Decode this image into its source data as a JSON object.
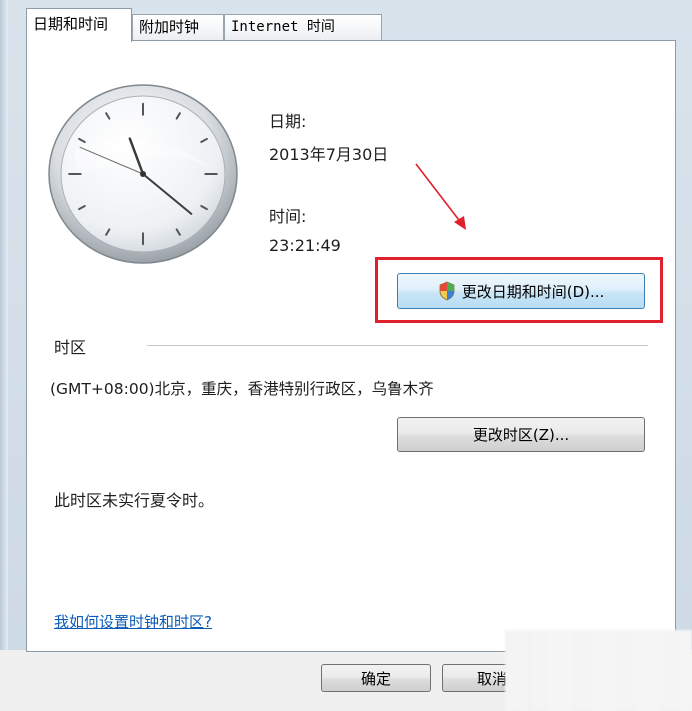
{
  "tabs": [
    {
      "label": "日期和时间",
      "active": true
    },
    {
      "label": "附加时钟",
      "active": false
    },
    {
      "label": "Internet 时间",
      "active": false
    }
  ],
  "date": {
    "label": "日期:",
    "value": "2013年7月30日"
  },
  "time": {
    "label": "时间:",
    "value": "23:21:49",
    "hour": 23,
    "minute": 21,
    "second": 49
  },
  "buttons": {
    "change_datetime": "更改日期和时间(D)...",
    "change_timezone": "更改时区(Z)...",
    "ok": "确定",
    "cancel": "取消"
  },
  "timezone": {
    "heading": "时区",
    "value": "(GMT+08:00)北京，重庆，香港特别行政区，乌鲁木齐",
    "dst_note": "此时区未实行夏令时。"
  },
  "help_link": "我如何设置时钟和时区?",
  "icons": {
    "clock": "analog-clock-icon",
    "shield": "uac-shield-icon",
    "arrow": "red-arrow-annotation"
  },
  "colors": {
    "highlight": "#e0202c",
    "link": "#0b5bb8",
    "panel_border": "#8e9aa4"
  }
}
